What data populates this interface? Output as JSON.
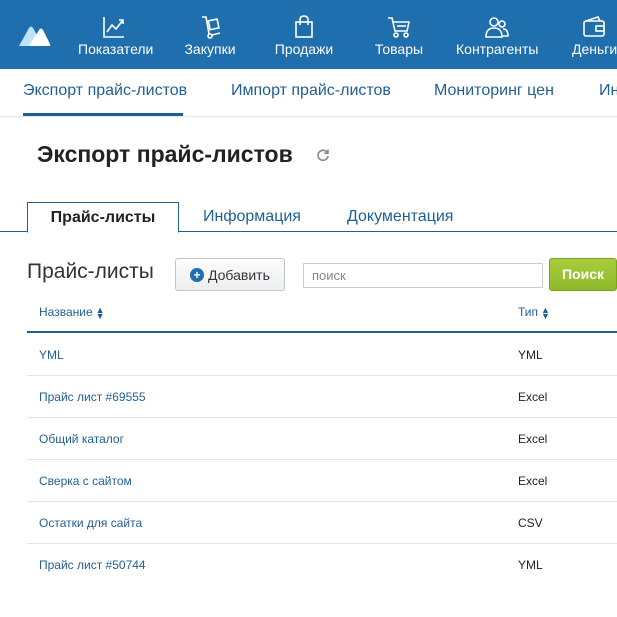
{
  "topnav": {
    "items": [
      {
        "label": "Показатели",
        "icon": "chart-line-icon"
      },
      {
        "label": "Закупки",
        "icon": "hand-truck-icon"
      },
      {
        "label": "Продажи",
        "icon": "shopping-bag-icon"
      },
      {
        "label": "Товары",
        "icon": "cart-icon"
      },
      {
        "label": "Контрагенты",
        "icon": "users-icon"
      },
      {
        "label": "Деньги",
        "icon": "wallet-icon"
      }
    ],
    "logo": "logo-icon"
  },
  "subnav": {
    "items": [
      {
        "label": "Экспорт прайс-листов",
        "active": true
      },
      {
        "label": "Импорт прайс-листов"
      },
      {
        "label": "Мониторинг цен"
      },
      {
        "label": "Ин"
      }
    ]
  },
  "page": {
    "title": "Экспорт прайс-листов"
  },
  "tabs": [
    {
      "label": "Прайс-листы",
      "active": true
    },
    {
      "label": "Информация"
    },
    {
      "label": "Документация"
    }
  ],
  "section": {
    "title": "Прайс-листы",
    "add_label": "Добавить",
    "search_placeholder": "поиск",
    "search_button": "Поиск"
  },
  "table": {
    "columns": [
      "Название",
      "Тип"
    ],
    "rows": [
      {
        "name": "YML",
        "type": "YML"
      },
      {
        "name": "Прайс лист #69555",
        "type": "Excel"
      },
      {
        "name": "Общий каталог",
        "type": "Excel"
      },
      {
        "name": "Сверка с сайтом",
        "type": "Excel"
      },
      {
        "name": "Остатки для сайта",
        "type": "CSV"
      },
      {
        "name": "Прайс лист #50744",
        "type": "YML"
      }
    ]
  },
  "colors": {
    "topnav_bg": "#1f6ead",
    "link": "#1f5f94",
    "search_button": "#9bc334"
  }
}
